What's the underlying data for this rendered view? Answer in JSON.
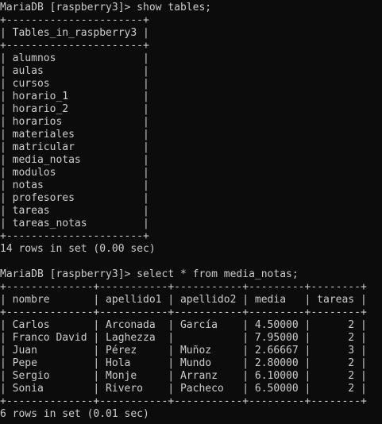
{
  "colors": {
    "background": "#0c0c0c",
    "foreground": "#cccccc"
  },
  "block1": {
    "prompt": "MariaDB [raspberry3]> show tables;",
    "border": "+----------------------+",
    "header": "| Tables_in_raspberry3 |",
    "rows": [
      "| alumnos              |",
      "| aulas                |",
      "| cursos               |",
      "| horario_1            |",
      "| horario_2            |",
      "| horarios             |",
      "| materiales           |",
      "| matricular           |",
      "| media_notas          |",
      "| modulos              |",
      "| notas                |",
      "| profesores           |",
      "| tareas               |",
      "| tareas_notas         |"
    ],
    "status": "14 rows in set (0.00 sec)"
  },
  "block2": {
    "prompt": "MariaDB [raspberry3]> select * from media_notas;",
    "border": "+--------------+-----------+-----------+---------+--------+",
    "header": "| nombre       | apellido1 | apellido2 | media   | tareas |",
    "rows": [
      "| Carlos       | Arconada  | García    | 4.50000 |      2 |",
      "| Franco David | Laghezza  |           | 7.95000 |      2 |",
      "| Juan         | Pérez     | Muñoz     | 2.66667 |      3 |",
      "| Pepe         | Hola      | Mundo     | 2.80000 |      2 |",
      "| Sergio       | Monje     | Arranz    | 6.10000 |      2 |",
      "| Sonia        | Rivero    | Pacheco   | 6.50000 |      2 |"
    ],
    "status": "6 rows in set (0.01 sec)"
  }
}
